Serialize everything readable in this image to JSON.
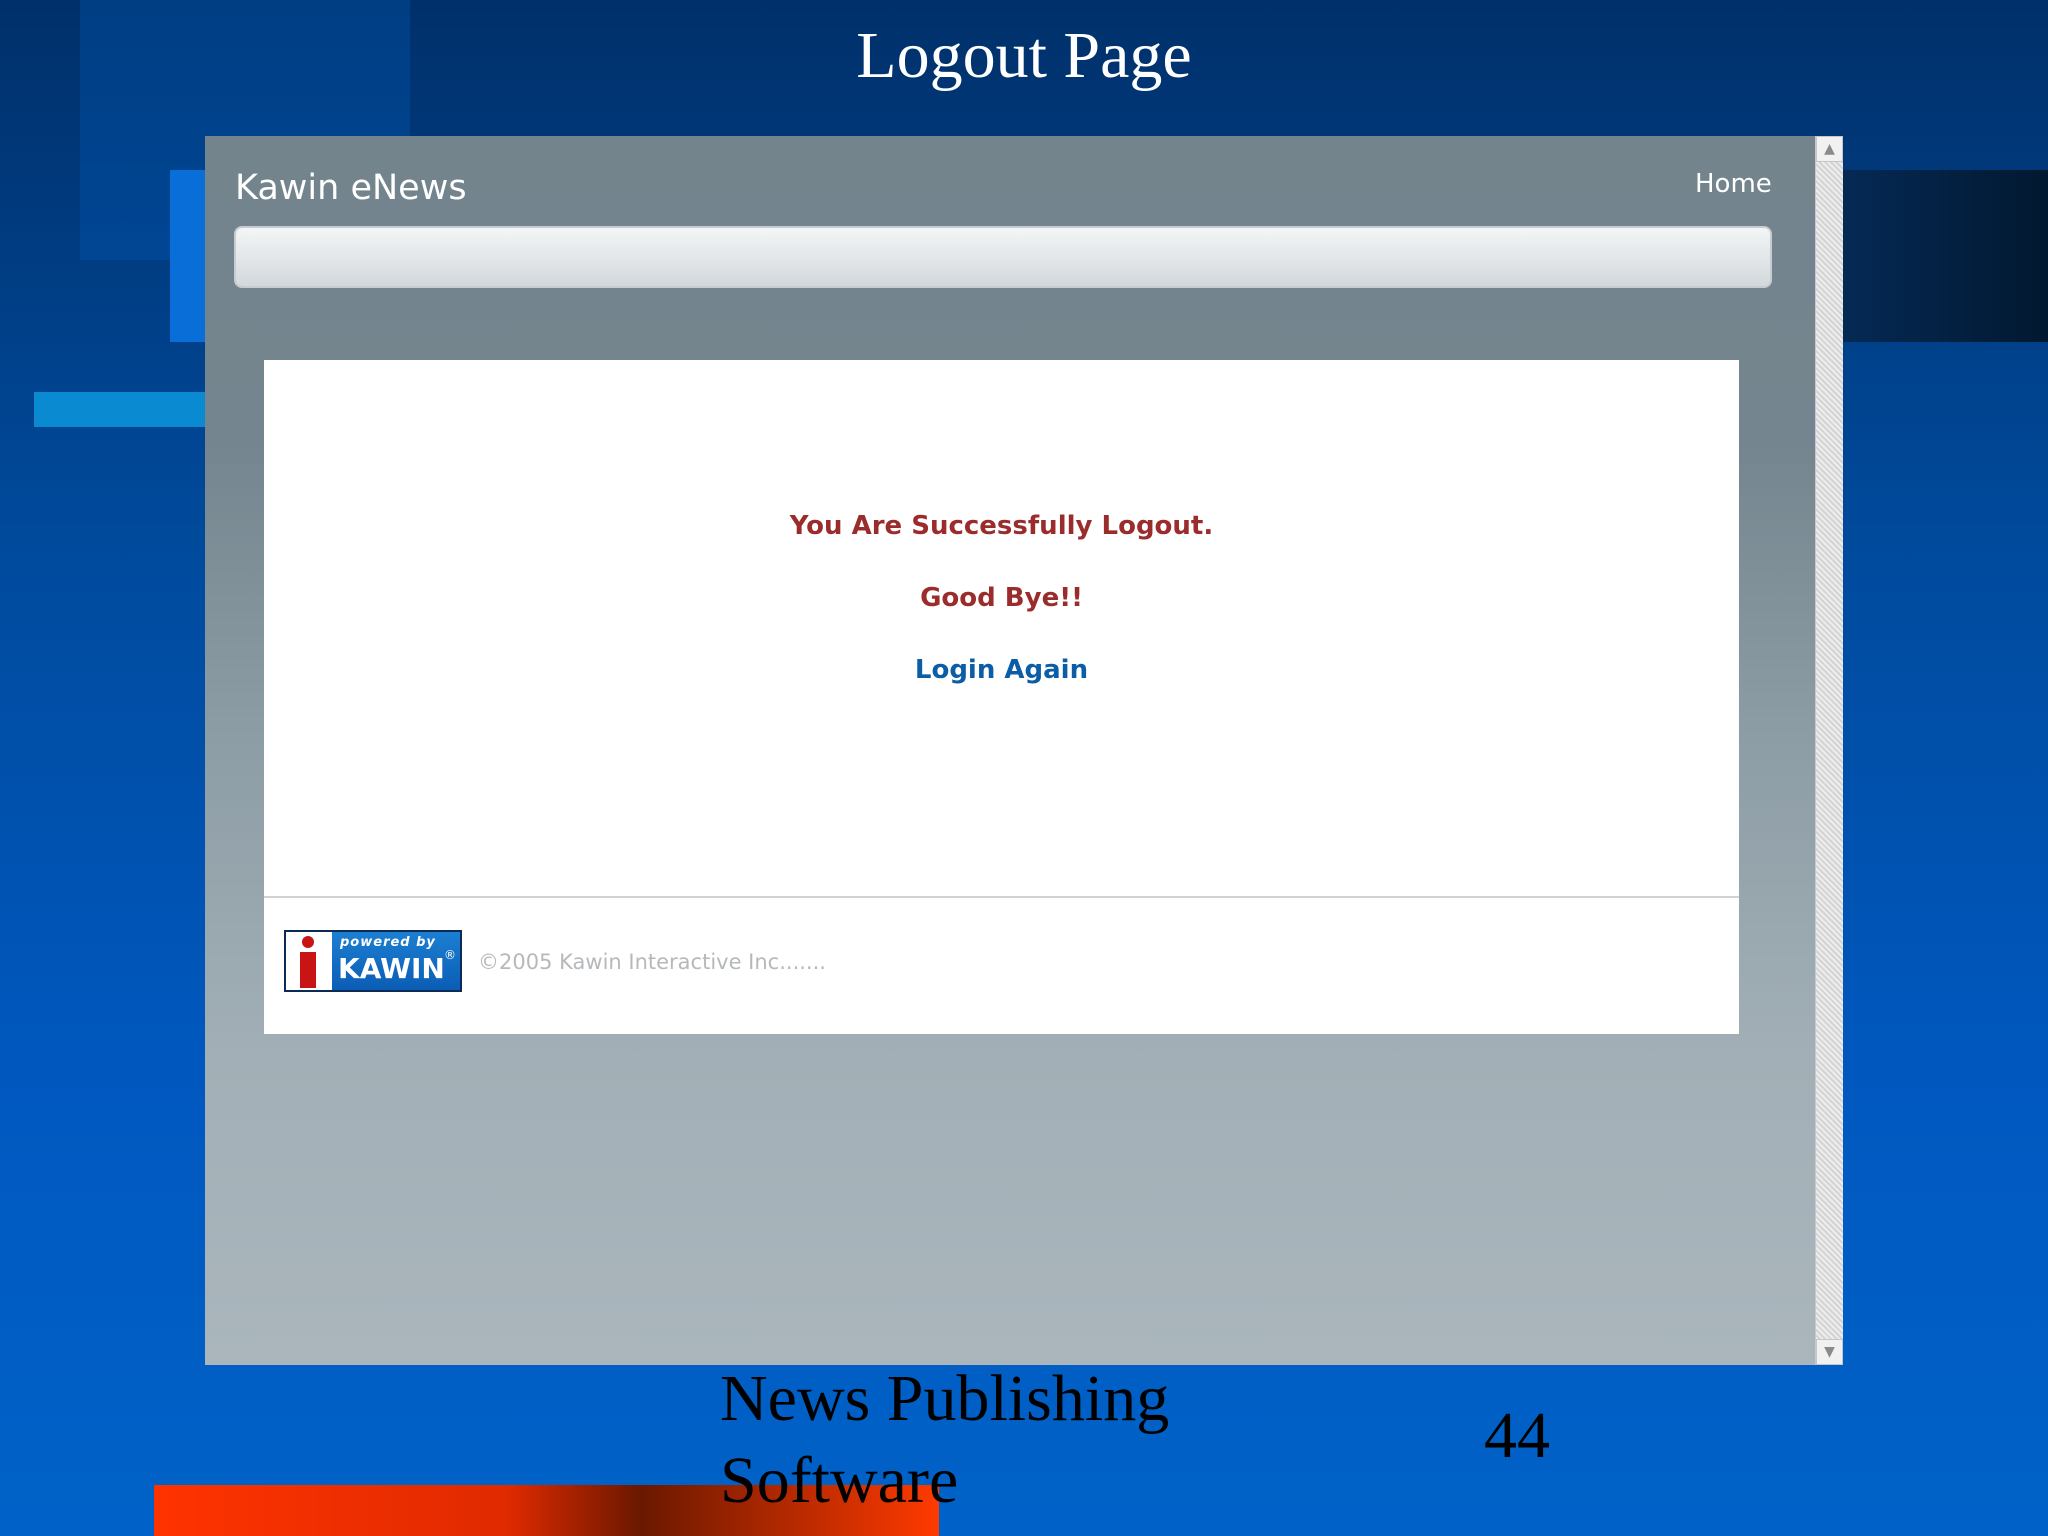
{
  "slide": {
    "title": "Logout Page",
    "footer": "News Publishing Software",
    "page_number": "44"
  },
  "app": {
    "brand": "Kawin eNews",
    "nav": {
      "home_label": "Home"
    },
    "messages": {
      "success": "You Are Successfully Logout.",
      "goodbye": "Good Bye!!",
      "login_again": "Login Again"
    },
    "footer": {
      "logo_powered_by": "powered by",
      "logo_name": "KAWIN",
      "logo_registered": "®",
      "copyright": "©2005 Kawin Interactive Inc......."
    }
  },
  "scrollbar": {
    "up_arrow": "▲",
    "down_arrow": "▼"
  },
  "colors": {
    "message_text": "#9b2c2c",
    "link_text": "#0b5da6",
    "slide_background": "#0058bf",
    "accent_red": "#ff3300"
  },
  "icons": {
    "scroll_up": "scroll-up-arrow-icon",
    "scroll_down": "scroll-down-arrow-icon",
    "logo": "kawin-i-logo-icon"
  }
}
